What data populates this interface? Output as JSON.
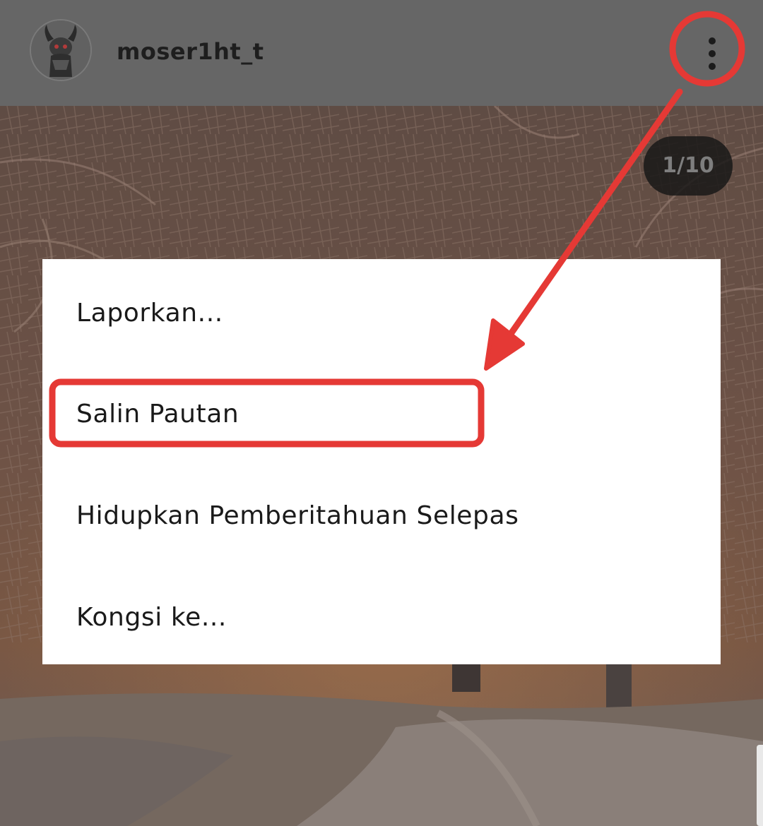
{
  "header": {
    "username": "moser1ht_t",
    "avatar_icon": "horned-character-avatar",
    "more_icon": "more-vertical-icon"
  },
  "post": {
    "counter": "1/10"
  },
  "menu": {
    "items": [
      {
        "label": "Laporkan..."
      },
      {
        "label": "Salin Pautan"
      },
      {
        "label": "Hidupkan Pemberitahuan Selepas"
      },
      {
        "label": "Kongsi ke..."
      }
    ]
  },
  "annotation": {
    "color": "#e53935"
  }
}
